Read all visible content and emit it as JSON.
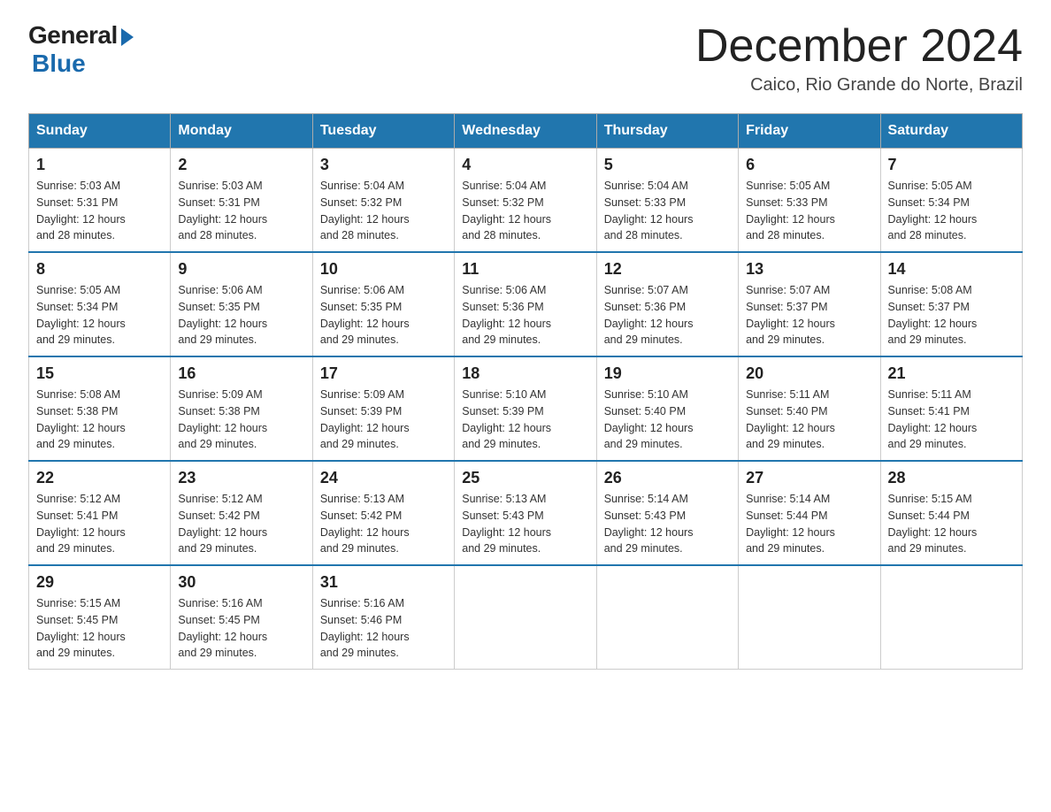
{
  "header": {
    "logo_general": "General",
    "logo_blue": "Blue",
    "title": "December 2024",
    "subtitle": "Caico, Rio Grande do Norte, Brazil"
  },
  "days_of_week": [
    "Sunday",
    "Monday",
    "Tuesday",
    "Wednesday",
    "Thursday",
    "Friday",
    "Saturday"
  ],
  "weeks": [
    [
      {
        "day": "1",
        "sunrise": "5:03 AM",
        "sunset": "5:31 PM",
        "daylight": "12 hours and 28 minutes."
      },
      {
        "day": "2",
        "sunrise": "5:03 AM",
        "sunset": "5:31 PM",
        "daylight": "12 hours and 28 minutes."
      },
      {
        "day": "3",
        "sunrise": "5:04 AM",
        "sunset": "5:32 PM",
        "daylight": "12 hours and 28 minutes."
      },
      {
        "day": "4",
        "sunrise": "5:04 AM",
        "sunset": "5:32 PM",
        "daylight": "12 hours and 28 minutes."
      },
      {
        "day": "5",
        "sunrise": "5:04 AM",
        "sunset": "5:33 PM",
        "daylight": "12 hours and 28 minutes."
      },
      {
        "day": "6",
        "sunrise": "5:05 AM",
        "sunset": "5:33 PM",
        "daylight": "12 hours and 28 minutes."
      },
      {
        "day": "7",
        "sunrise": "5:05 AM",
        "sunset": "5:34 PM",
        "daylight": "12 hours and 28 minutes."
      }
    ],
    [
      {
        "day": "8",
        "sunrise": "5:05 AM",
        "sunset": "5:34 PM",
        "daylight": "12 hours and 29 minutes."
      },
      {
        "day": "9",
        "sunrise": "5:06 AM",
        "sunset": "5:35 PM",
        "daylight": "12 hours and 29 minutes."
      },
      {
        "day": "10",
        "sunrise": "5:06 AM",
        "sunset": "5:35 PM",
        "daylight": "12 hours and 29 minutes."
      },
      {
        "day": "11",
        "sunrise": "5:06 AM",
        "sunset": "5:36 PM",
        "daylight": "12 hours and 29 minutes."
      },
      {
        "day": "12",
        "sunrise": "5:07 AM",
        "sunset": "5:36 PM",
        "daylight": "12 hours and 29 minutes."
      },
      {
        "day": "13",
        "sunrise": "5:07 AM",
        "sunset": "5:37 PM",
        "daylight": "12 hours and 29 minutes."
      },
      {
        "day": "14",
        "sunrise": "5:08 AM",
        "sunset": "5:37 PM",
        "daylight": "12 hours and 29 minutes."
      }
    ],
    [
      {
        "day": "15",
        "sunrise": "5:08 AM",
        "sunset": "5:38 PM",
        "daylight": "12 hours and 29 minutes."
      },
      {
        "day": "16",
        "sunrise": "5:09 AM",
        "sunset": "5:38 PM",
        "daylight": "12 hours and 29 minutes."
      },
      {
        "day": "17",
        "sunrise": "5:09 AM",
        "sunset": "5:39 PM",
        "daylight": "12 hours and 29 minutes."
      },
      {
        "day": "18",
        "sunrise": "5:10 AM",
        "sunset": "5:39 PM",
        "daylight": "12 hours and 29 minutes."
      },
      {
        "day": "19",
        "sunrise": "5:10 AM",
        "sunset": "5:40 PM",
        "daylight": "12 hours and 29 minutes."
      },
      {
        "day": "20",
        "sunrise": "5:11 AM",
        "sunset": "5:40 PM",
        "daylight": "12 hours and 29 minutes."
      },
      {
        "day": "21",
        "sunrise": "5:11 AM",
        "sunset": "5:41 PM",
        "daylight": "12 hours and 29 minutes."
      }
    ],
    [
      {
        "day": "22",
        "sunrise": "5:12 AM",
        "sunset": "5:41 PM",
        "daylight": "12 hours and 29 minutes."
      },
      {
        "day": "23",
        "sunrise": "5:12 AM",
        "sunset": "5:42 PM",
        "daylight": "12 hours and 29 minutes."
      },
      {
        "day": "24",
        "sunrise": "5:13 AM",
        "sunset": "5:42 PM",
        "daylight": "12 hours and 29 minutes."
      },
      {
        "day": "25",
        "sunrise": "5:13 AM",
        "sunset": "5:43 PM",
        "daylight": "12 hours and 29 minutes."
      },
      {
        "day": "26",
        "sunrise": "5:14 AM",
        "sunset": "5:43 PM",
        "daylight": "12 hours and 29 minutes."
      },
      {
        "day": "27",
        "sunrise": "5:14 AM",
        "sunset": "5:44 PM",
        "daylight": "12 hours and 29 minutes."
      },
      {
        "day": "28",
        "sunrise": "5:15 AM",
        "sunset": "5:44 PM",
        "daylight": "12 hours and 29 minutes."
      }
    ],
    [
      {
        "day": "29",
        "sunrise": "5:15 AM",
        "sunset": "5:45 PM",
        "daylight": "12 hours and 29 minutes."
      },
      {
        "day": "30",
        "sunrise": "5:16 AM",
        "sunset": "5:45 PM",
        "daylight": "12 hours and 29 minutes."
      },
      {
        "day": "31",
        "sunrise": "5:16 AM",
        "sunset": "5:46 PM",
        "daylight": "12 hours and 29 minutes."
      },
      null,
      null,
      null,
      null
    ]
  ],
  "labels": {
    "sunrise": "Sunrise:",
    "sunset": "Sunset:",
    "daylight": "Daylight:"
  }
}
